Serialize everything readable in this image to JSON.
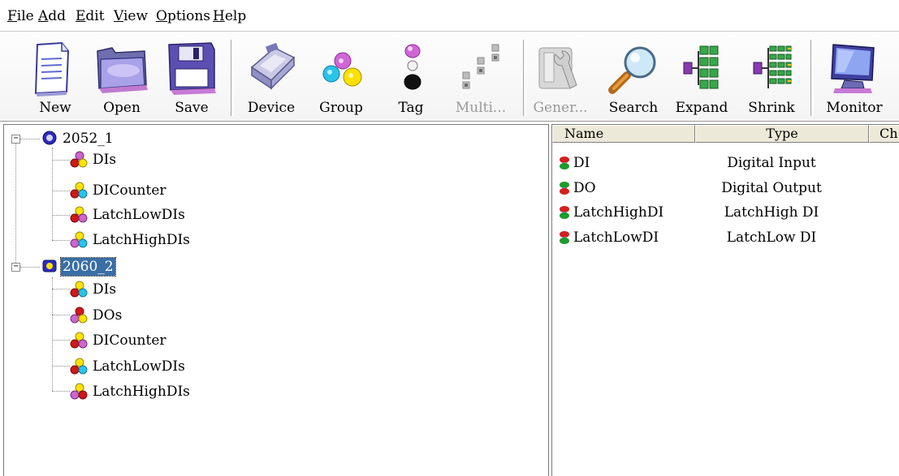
{
  "menu": [
    "File",
    "Add",
    "Edit",
    "View",
    "Options",
    "Help"
  ],
  "toolbar": {
    "buttons": [
      {
        "label": "New",
        "icon": "new-document-icon"
      },
      {
        "label": "Open",
        "icon": "open-folder-icon"
      },
      {
        "label": "Save",
        "icon": "save-disk-icon"
      },
      {
        "label": "Device",
        "icon": "device-module-icon"
      },
      {
        "label": "Group",
        "icon": "group-circles-icon"
      },
      {
        "label": "Tag",
        "icon": "tag-icon"
      },
      {
        "label": "Multi...",
        "icon": "multi-tag-icon",
        "disabled": true
      },
      {
        "label": "Gener...",
        "icon": "generate-tools-icon",
        "disabled": true
      },
      {
        "label": "Search",
        "icon": "magnifier-icon"
      },
      {
        "label": "Expand",
        "icon": "expand-tree-icon"
      },
      {
        "label": "Shrink",
        "icon": "shrink-tree-icon"
      },
      {
        "label": "Monitor",
        "icon": "monitor-icon"
      }
    ]
  },
  "tree": {
    "devices": [
      {
        "name": "2052_1",
        "expanded": true,
        "selected": false,
        "groups": [
          "DIs",
          "DICounter",
          "LatchLowDIs",
          "LatchHighDIs"
        ]
      },
      {
        "name": "2060_2",
        "expanded": true,
        "selected": true,
        "groups": [
          "DIs",
          "DOs",
          "DICounter",
          "LatchLowDIs",
          "LatchHighDIs"
        ]
      }
    ]
  },
  "list": {
    "columns": [
      "Name",
      "Type",
      "Ch"
    ],
    "rows": [
      {
        "name": "DI",
        "type": "Digital Input"
      },
      {
        "name": "DO",
        "type": "Digital Output"
      },
      {
        "name": "LatchHighDI",
        "type": "LatchHigh DI"
      },
      {
        "name": "LatchLowDI",
        "type": "LatchLow DI"
      }
    ]
  },
  "colors": {
    "selection": "#3a6ea5",
    "tag_red": "#d42020",
    "tag_green": "#1f9a2c",
    "group_red": "#d01818",
    "group_yellow": "#ffe400",
    "group_purple": "#cc66cc"
  }
}
